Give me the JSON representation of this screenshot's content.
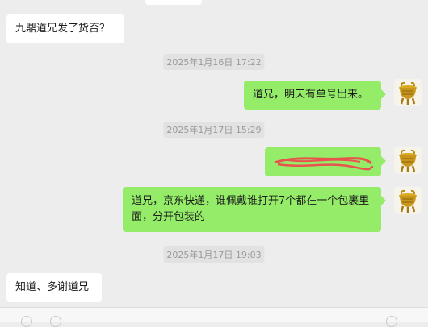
{
  "messages": [
    {
      "id": "m1",
      "side": "left",
      "text": "九鼎道兄发了货否？"
    },
    {
      "id": "t1",
      "type": "timestamp",
      "text": "2025年1月16日 17:22"
    },
    {
      "id": "m2",
      "side": "right",
      "text": "道兄，明天有单号出来。"
    },
    {
      "id": "t2",
      "type": "timestamp",
      "text": "2025年1月17日 15:29"
    },
    {
      "id": "m3",
      "side": "right",
      "text": ""
    },
    {
      "id": "m4",
      "side": "right",
      "text": "道兄，京东快递，谁佩戴谁打开7个都在一个包裹里面，分开包装的"
    },
    {
      "id": "t3",
      "type": "timestamp",
      "text": "2025年1月17日 19:03"
    },
    {
      "id": "m5",
      "side": "left",
      "text": "知道、多谢道兄"
    }
  ],
  "colors": {
    "background": "#ededed",
    "left_bubble": "#ffffff",
    "right_bubble": "#95ec69",
    "timestamp_text": "#9a9a9a",
    "scribble": "#e8534d"
  },
  "icons": {
    "avatar": "golden-ding-cauldron-icon"
  }
}
